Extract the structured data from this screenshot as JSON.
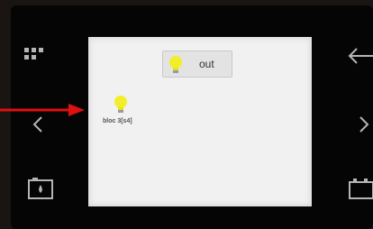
{
  "screen": {
    "out_button": {
      "label": "out",
      "icon": "lightbulb-icon"
    },
    "bloc_item": {
      "label": "bloc 3[s4]",
      "icon": "lightbulb-icon"
    }
  },
  "side_controls": {
    "left": [
      "grid-menu-icon",
      "chevron-left-icon",
      "water-tank-icon"
    ],
    "right": [
      "back-arrow-icon",
      "chevron-right-icon",
      "battery-icon"
    ]
  },
  "colors": {
    "bezel": "#050505",
    "screen_bg": "#f1f1f1",
    "bulb": "#f2ef2a",
    "icon": "#b5b5b5",
    "annotation_arrow": "#e01010"
  },
  "annotation": "red-arrow-pointer"
}
